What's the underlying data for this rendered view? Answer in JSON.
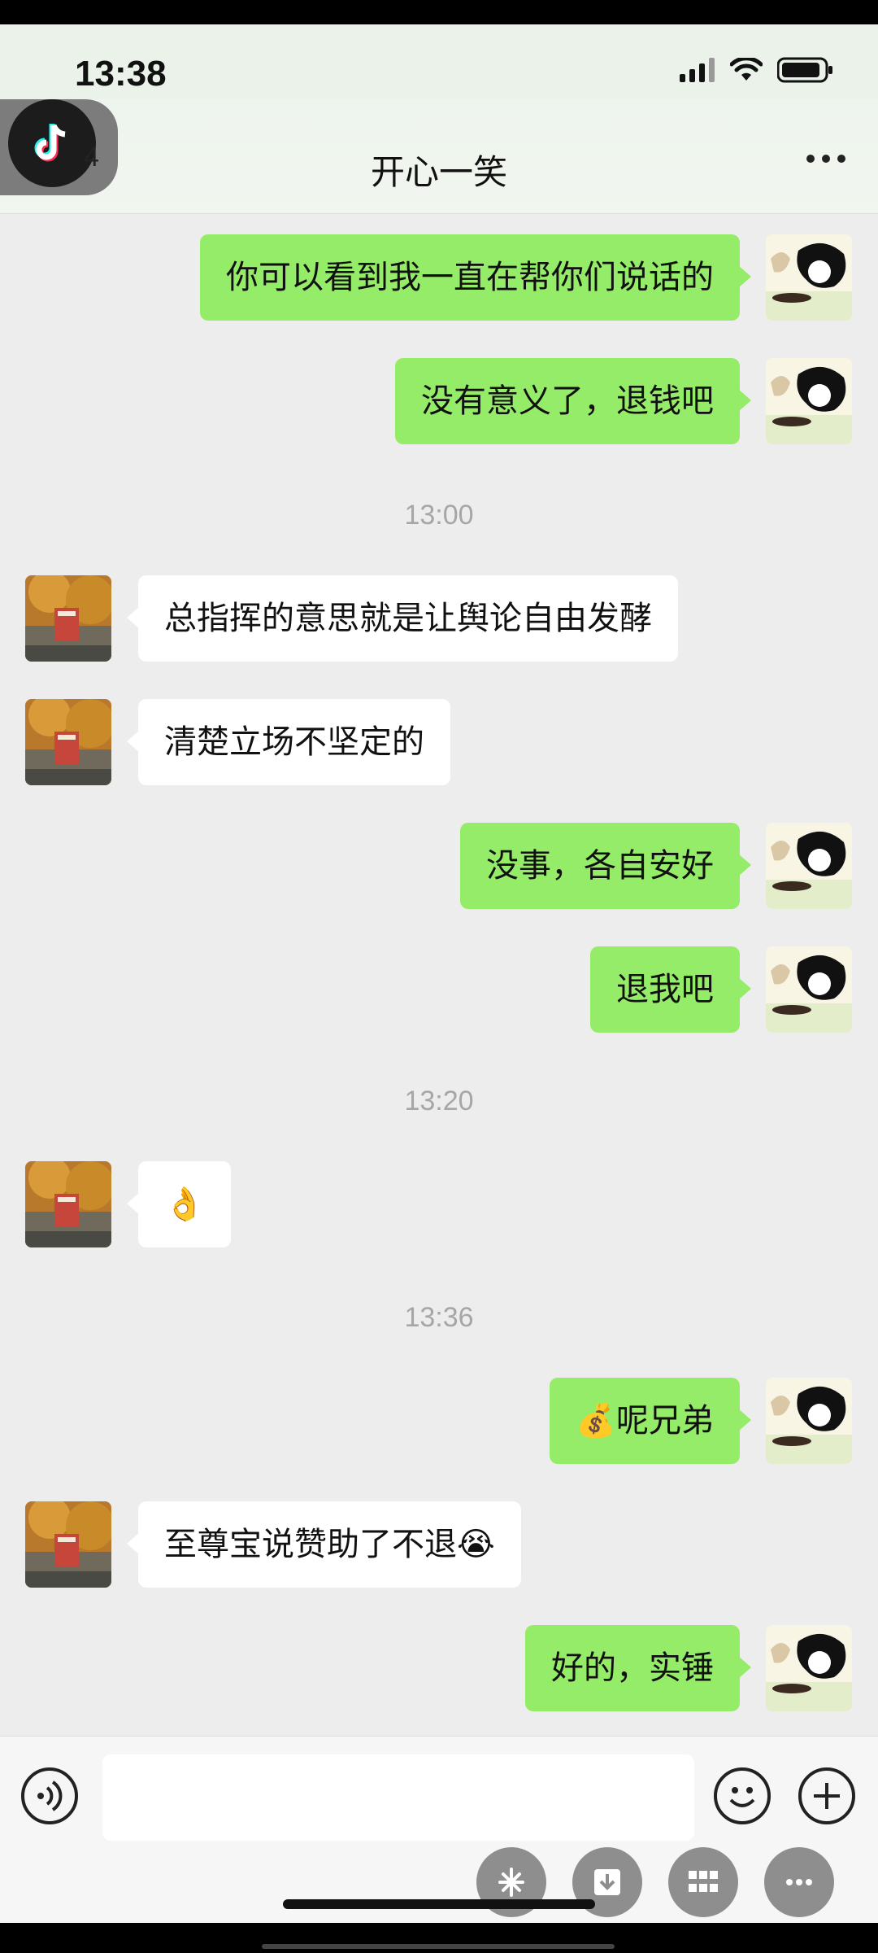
{
  "status": {
    "time": "13:38"
  },
  "nav": {
    "unread": "4",
    "title": "开心一笑"
  },
  "messages": [
    {
      "side": "me",
      "text": "你可以看到我一直在帮你们说话的"
    },
    {
      "side": "me",
      "text": "没有意义了，退钱吧"
    },
    {
      "side": "time",
      "text": "13:00"
    },
    {
      "side": "them",
      "text": "总指挥的意思就是让舆论自由发酵"
    },
    {
      "side": "them",
      "text": "清楚立场不坚定的"
    },
    {
      "side": "me",
      "text": "没事，各自安好"
    },
    {
      "side": "me",
      "text": "退我吧"
    },
    {
      "side": "time",
      "text": "13:20"
    },
    {
      "side": "them",
      "text": "👌"
    },
    {
      "side": "time",
      "text": "13:36"
    },
    {
      "side": "me",
      "text": "💰呢兄弟"
    },
    {
      "side": "them",
      "text": "至尊宝说赞助了不退😭"
    },
    {
      "side": "me",
      "text": "好的，实锤"
    }
  ],
  "colors": {
    "my_bubble": "#95ec69",
    "their_bubble": "#ffffff",
    "background": "#ededed"
  }
}
